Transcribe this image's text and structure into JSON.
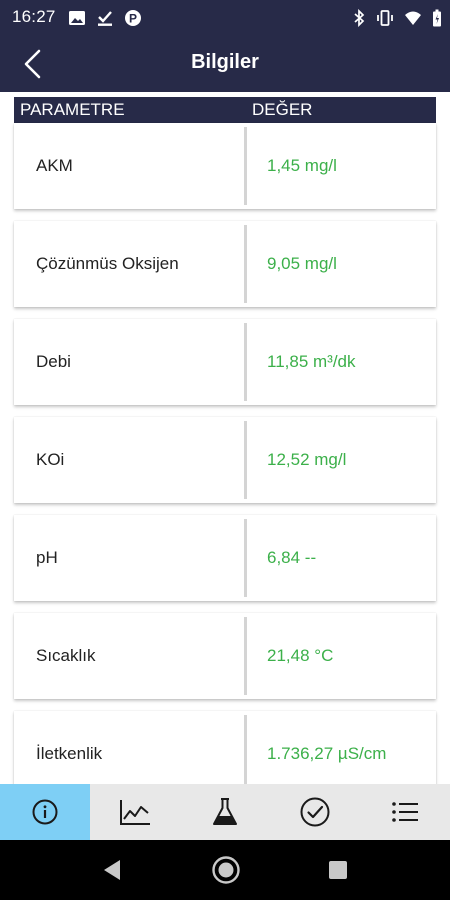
{
  "status": {
    "time": "16:27"
  },
  "appbar": {
    "title": "Bilgiler"
  },
  "table": {
    "header_param": "PARAMETRE",
    "header_value": "DEĞER",
    "rows": [
      {
        "param": "AKM",
        "value": "1,45 mg/l"
      },
      {
        "param": "Çözünmüs Oksijen",
        "value": "9,05 mg/l"
      },
      {
        "param": "Debi",
        "value": "11,85 m³/dk"
      },
      {
        "param": "KOi",
        "value": "12,52 mg/l"
      },
      {
        "param": "pH",
        "value": "6,84 --"
      },
      {
        "param": "Sıcaklık",
        "value": "21,48 °C"
      },
      {
        "param": "İletkenlik",
        "value": "1.736,27 µS/cm"
      }
    ]
  },
  "colors": {
    "header": "#272a48",
    "value": "#3cb04a",
    "active_tab": "#7ecff5",
    "nav_bg": "#e8e8e8"
  },
  "bottom_nav": {
    "items": [
      {
        "icon": "info-icon",
        "active": true
      },
      {
        "icon": "chart-icon",
        "active": false
      },
      {
        "icon": "flask-icon",
        "active": false
      },
      {
        "icon": "check-circle-icon",
        "active": false
      },
      {
        "icon": "list-icon",
        "active": false
      }
    ]
  }
}
